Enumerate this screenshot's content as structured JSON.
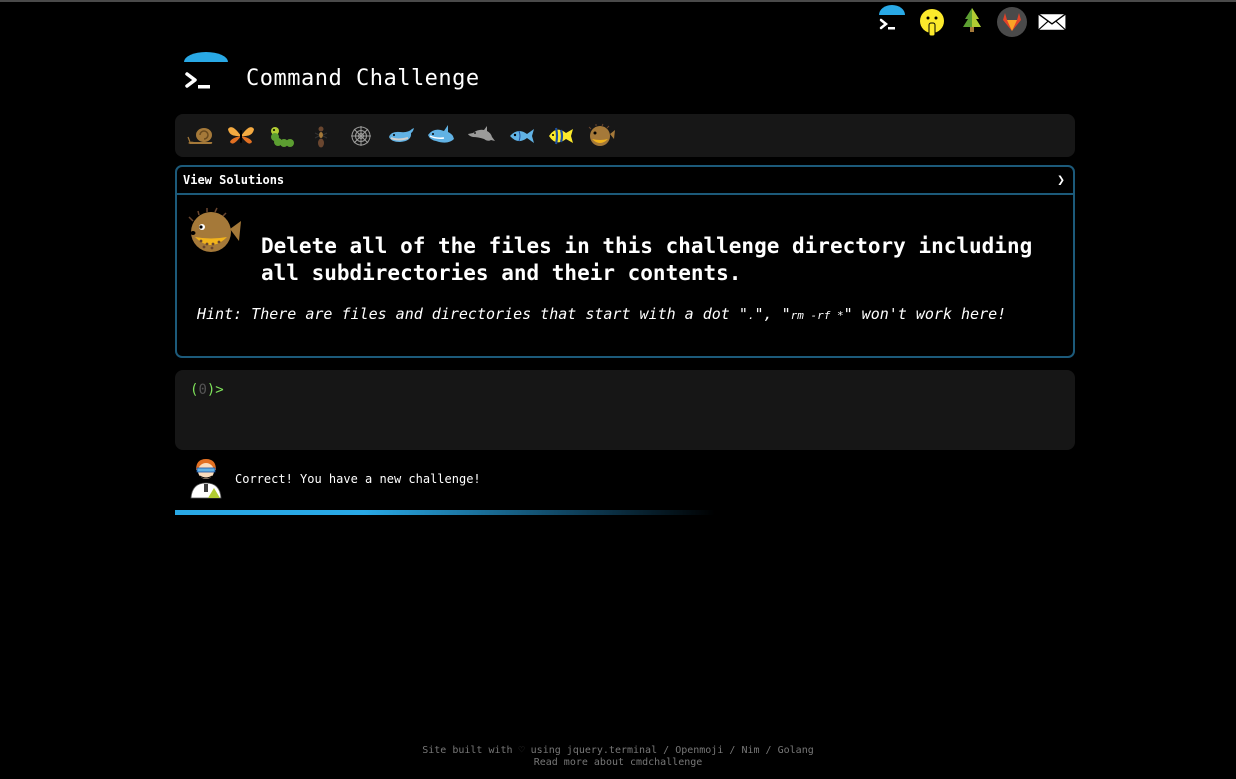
{
  "header": {
    "title": "Command Challenge"
  },
  "top_icons": [
    {
      "name": "cmdchallenge-logo-icon"
    },
    {
      "name": "shushing-face-icon"
    },
    {
      "name": "tree-icon"
    },
    {
      "name": "gitlab-icon"
    },
    {
      "name": "mail-icon"
    }
  ],
  "challenge_bar": [
    {
      "name": "snail-icon"
    },
    {
      "name": "butterfly-icon"
    },
    {
      "name": "caterpillar-icon"
    },
    {
      "name": "ant-icon"
    },
    {
      "name": "spider-web-icon"
    },
    {
      "name": "whale-icon"
    },
    {
      "name": "shark-icon"
    },
    {
      "name": "dolphin-icon"
    },
    {
      "name": "fish-icon"
    },
    {
      "name": "tropical-fish-icon"
    },
    {
      "name": "blowfish-icon"
    }
  ],
  "panel": {
    "view_solutions": "View Solutions",
    "arrow": "❯",
    "task": "Delete all of the files in this challenge directory including all subdirectories and their contents.",
    "hint_prefix": "Hint: There are files and directories that start with a dot \"",
    "hint_dot": ".",
    "hint_mid": "\", \"",
    "hint_code": "rm -rf *",
    "hint_suffix": "\" won't work here!"
  },
  "terminal": {
    "open": "(",
    "count": "0",
    "close": ")>"
  },
  "status": {
    "message": "Correct! You have a new challenge!",
    "progress_fraction": 0.6
  },
  "footer": {
    "line1_a": "Site built with",
    "line1_heart": "♡",
    "line1_b": "using jquery.terminal",
    "sep": "/",
    "openmoji": "Openmoji",
    "nim": "Nim",
    "golang": "Golang",
    "line2": "Read more about cmdchallenge"
  },
  "colors": {
    "accent": "#29a9e6",
    "panel_border": "#1c5a7a",
    "prompt": "#7ee15a"
  }
}
